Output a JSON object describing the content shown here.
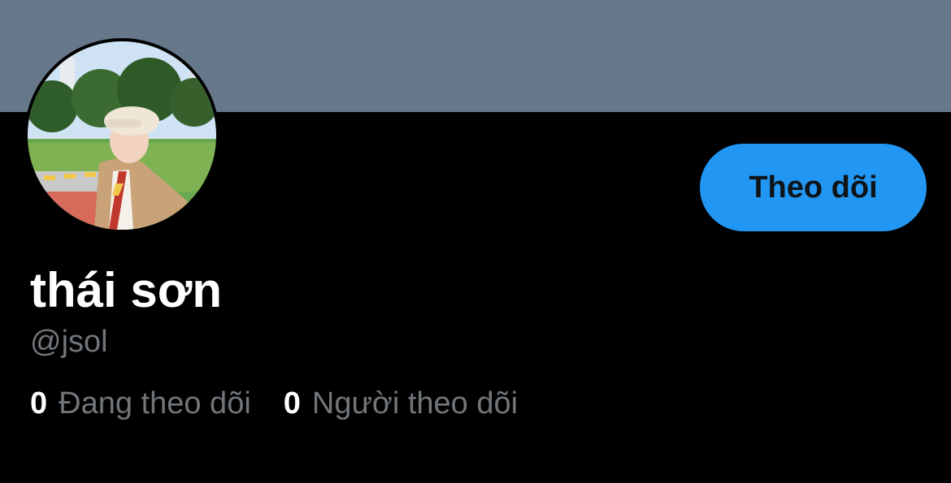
{
  "profile": {
    "display_name": "thái sơn",
    "handle": "@jsol",
    "follow_button_label": "Theo dõi",
    "avatar_icon": "profile-photo",
    "stats": {
      "following_count": "0",
      "following_label": "Đang theo dõi",
      "followers_count": "0",
      "followers_label": "Người theo dõi"
    }
  },
  "colors": {
    "banner": "#66788a",
    "background": "#000000",
    "accent": "#2196f3",
    "secondary_text": "#71767b",
    "primary_text": "#ffffff"
  }
}
